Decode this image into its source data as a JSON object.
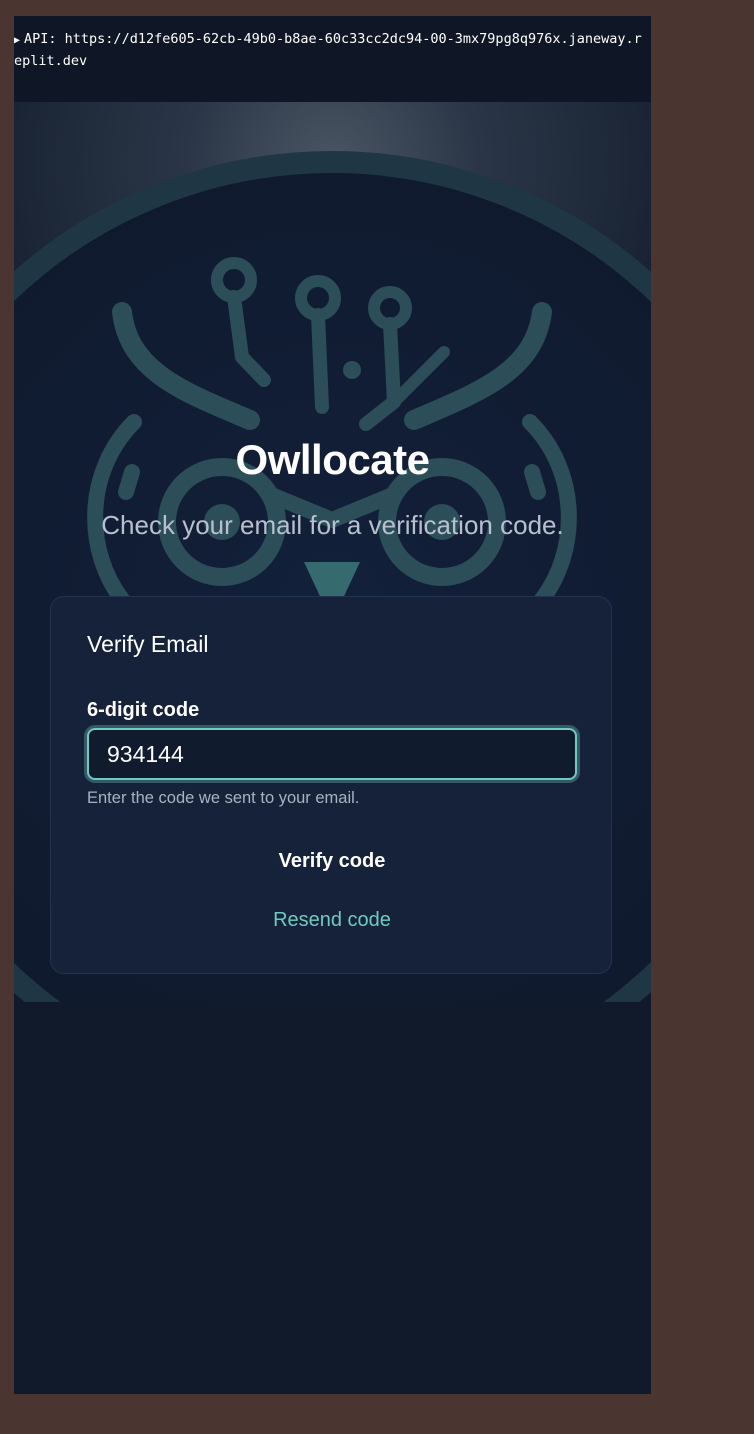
{
  "api_bar": {
    "toggle_glyph": "▶",
    "text": "API: https://d12fe605-62cb-49b0-b8ae-60c33cc2dc94-00-3mx79pg8q976x.janeway.replit.dev"
  },
  "hero": {
    "logo_icon": "owl-circuit-icon",
    "title": "Owllocate",
    "subtitle": "Check your email for a verification code."
  },
  "card": {
    "title": "Verify Email",
    "code_field": {
      "label": "6-digit code",
      "value": "934144",
      "hint": "Enter the code we sent to your email."
    },
    "verify_button": "Verify code",
    "resend_link": "Resend code"
  },
  "colors": {
    "page_background": "#111a2b",
    "card_background": "#16223a",
    "accent": "#6fcbbf",
    "logo": "#2b4e58"
  }
}
